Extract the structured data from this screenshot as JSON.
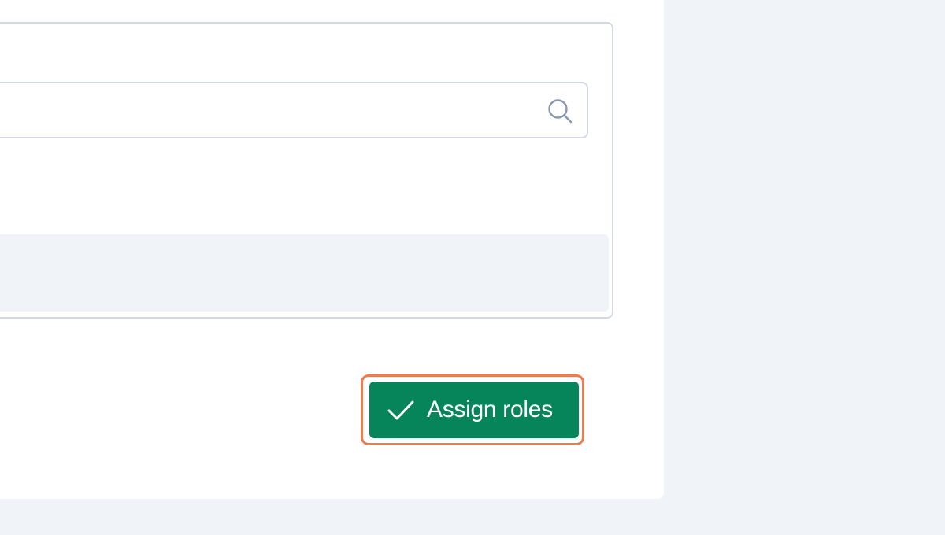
{
  "search": {
    "value": "",
    "placeholder": ""
  },
  "icons": {
    "search": "search-icon",
    "check": "check-icon"
  },
  "actions": {
    "assign_label": "Assign roles"
  },
  "colors": {
    "page_background": "#f0f3f8",
    "modal_background": "#ffffff",
    "border": "#d2d9e5",
    "primary_button": "#07855a",
    "focus_ring": "#f07a4a",
    "icon_muted": "#8a98b0"
  }
}
